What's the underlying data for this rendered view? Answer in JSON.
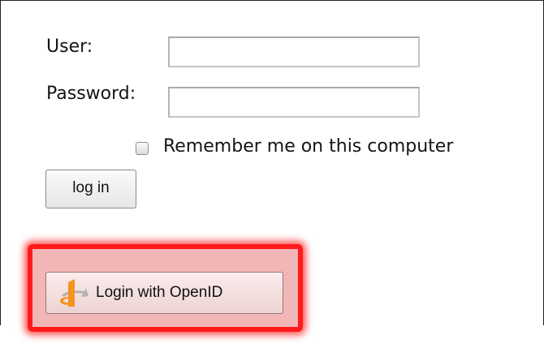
{
  "login_form": {
    "user_label": "User:",
    "user_value": "",
    "password_label": "Password:",
    "password_value": "",
    "remember_label": "Remember me on this computer",
    "remember_checked": false,
    "login_button_label": "log in"
  },
  "openid": {
    "button_label": "Login with OpenID",
    "icon": "openid-icon",
    "highlighted": true
  },
  "colors": {
    "highlight_border": "#ff1a1a",
    "highlight_fill": "#f3b6b6",
    "openid_orange": "#f7931e",
    "openid_gray": "#b3b3b3"
  }
}
